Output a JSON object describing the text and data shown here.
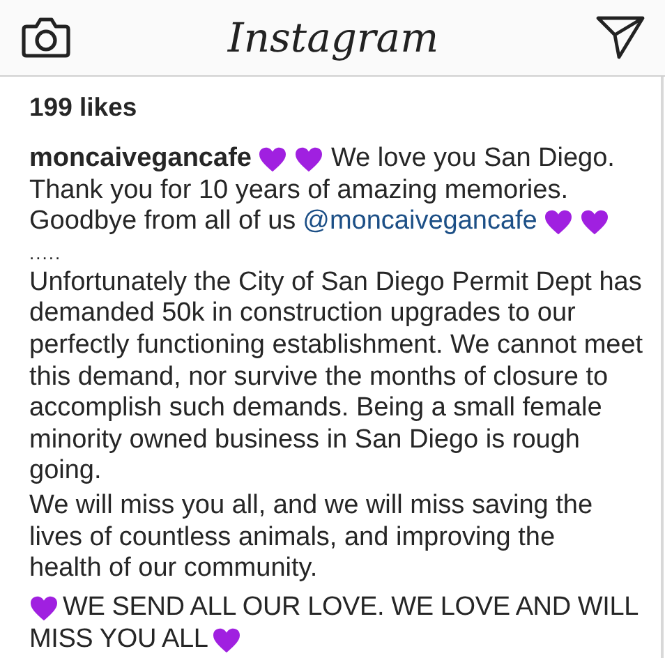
{
  "header": {
    "logo": "Instagram"
  },
  "likes": "199 likes",
  "caption": [
    [
      {
        "kind": "bold",
        "text": "moncaivegancafe"
      },
      {
        "kind": "heart"
      },
      {
        "kind": "heart"
      },
      {
        "kind": "text",
        "text": "We love you San Diego."
      }
    ],
    [
      {
        "kind": "text",
        "text": "Thank you for 10 years of amazing memories."
      }
    ],
    [
      {
        "kind": "text",
        "text": "Goodbye from all of us"
      },
      {
        "kind": "mention",
        "text": "@moncaivegancafe"
      },
      {
        "kind": "heart"
      },
      {
        "kind": "heart"
      }
    ]
  ],
  "separator": ".....",
  "paragraphs": [
    "Unfortunately the City of San Diego Permit Dept has demanded 50k in construction upgrades to our perfectly functioning establishment. We cannot meet this demand, nor survive the months of closure to accomplish such demands. Being a small female minority owned business in San Diego is rough going.",
    "We will miss you all, and we will miss saving the lives of countless animals, and improving the health of our community."
  ],
  "closing": [
    [
      {
        "kind": "heart"
      },
      {
        "kind": "text",
        "text": "WE SEND ALL OUR LOVE. WE LOVE AND WILL"
      }
    ],
    [
      {
        "kind": "text",
        "text": "MISS YOU ALL"
      },
      {
        "kind": "heart"
      }
    ]
  ]
}
